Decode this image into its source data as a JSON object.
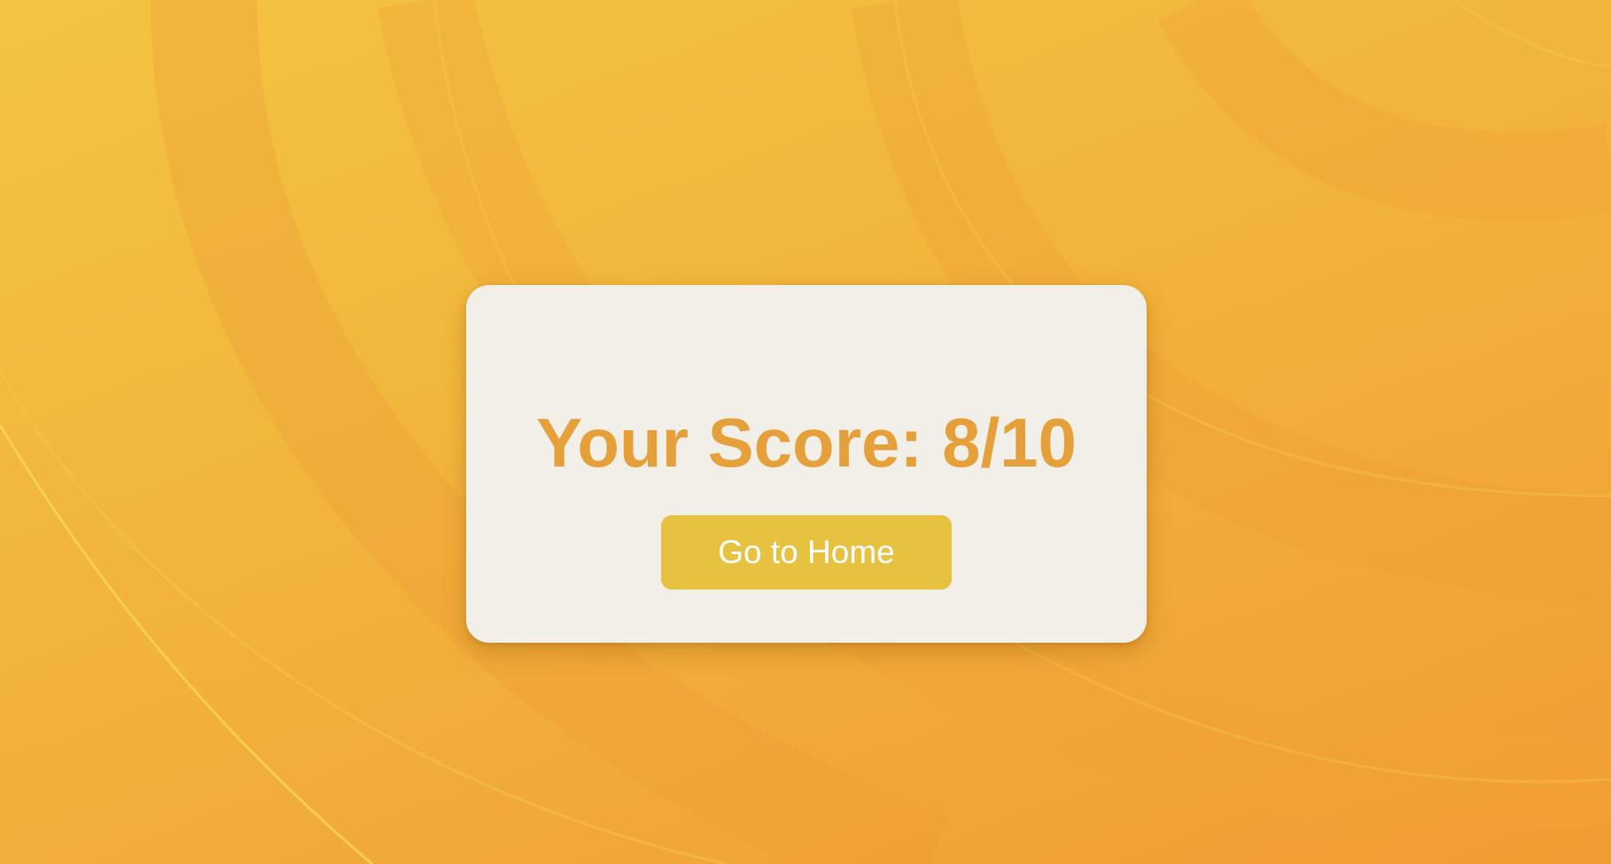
{
  "result": {
    "score_text": "Your Score: 8/10",
    "score": 8,
    "total": 10
  },
  "actions": {
    "home_label": "Go to Home"
  },
  "colors": {
    "background_light": "#f4c442",
    "background_dark": "#f09c34",
    "card": "#f2eee8",
    "score_text": "#e5a03a",
    "button": "#e6c240",
    "button_text": "#ffffff"
  }
}
